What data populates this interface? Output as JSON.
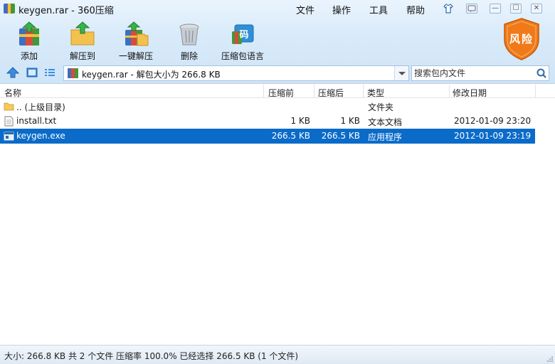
{
  "window": {
    "title": "keygen.rar - 360压缩",
    "menu": [
      "文件",
      "操作",
      "工具",
      "帮助"
    ],
    "controls": {
      "minimize": "—",
      "maximize": "☐",
      "close": "✕"
    }
  },
  "toolbar": {
    "items": [
      {
        "label": "添加",
        "icon": "add-archive-icon"
      },
      {
        "label": "解压到",
        "icon": "extract-to-icon"
      },
      {
        "label": "一键解压",
        "icon": "one-click-extract-icon"
      },
      {
        "label": "删除",
        "icon": "delete-trash-icon"
      },
      {
        "label": "压缩包语言",
        "icon": "archive-language-icon"
      }
    ],
    "language_glyph": "码",
    "risk_badge": "风险"
  },
  "address": {
    "path": "keygen.rar - 解包大小为 266.8 KB",
    "search_placeholder": "搜索包内文件"
  },
  "columns": [
    "名称",
    "压缩前",
    "压缩后",
    "类型",
    "修改日期"
  ],
  "rows": [
    {
      "name": ".. (上级目录)",
      "before": "",
      "after": "",
      "type": "文件夹",
      "date": "",
      "icon": "folder-icon",
      "selected": false
    },
    {
      "name": "install.txt",
      "before": "1 KB",
      "after": "1 KB",
      "type": "文本文档",
      "date": "2012-01-09 23:20",
      "icon": "text-file-icon",
      "selected": false
    },
    {
      "name": "keygen.exe",
      "before": "266.5 KB",
      "after": "266.5 KB",
      "type": "应用程序",
      "date": "2012-01-09 23:19",
      "icon": "exe-file-icon",
      "selected": true
    }
  ],
  "status": {
    "text": "大小: 266.8 KB 共 2 个文件 压缩率 100.0% 已经选择 266.5 KB (1 个文件)"
  },
  "colors": {
    "selection": "#0a6bc9",
    "chrome_top": "#eaf4fd",
    "risk_badge": "#f07a1a"
  }
}
